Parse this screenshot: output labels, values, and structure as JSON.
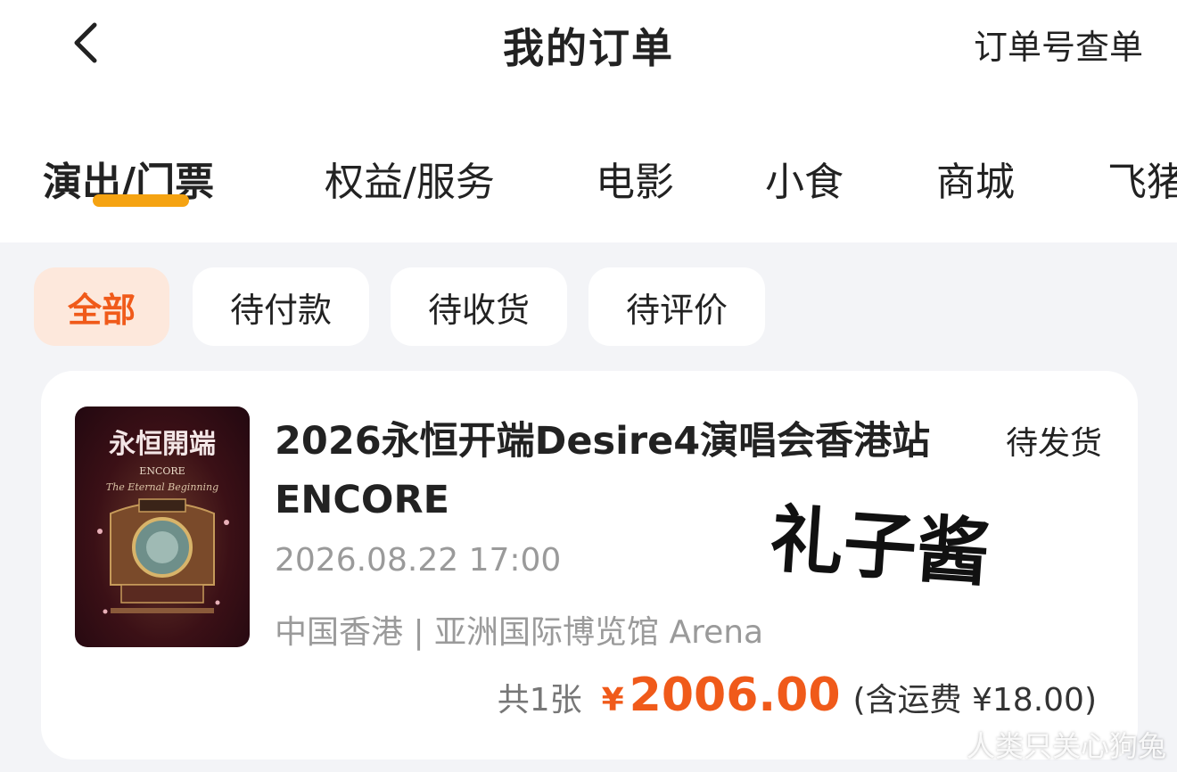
{
  "header": {
    "back_icon": "chevron-left-icon",
    "title": "我的订单",
    "lookup": "订单号查单"
  },
  "tabs": [
    {
      "label": "演出/门票",
      "active": true
    },
    {
      "label": "权益/服务",
      "active": false
    },
    {
      "label": "电影",
      "active": false
    },
    {
      "label": "小食",
      "active": false
    },
    {
      "label": "商城",
      "active": false
    },
    {
      "label": "飞猪",
      "active": false
    }
  ],
  "filters": [
    {
      "label": "全部",
      "active": true
    },
    {
      "label": "待付款",
      "active": false
    },
    {
      "label": "待收货",
      "active": false
    },
    {
      "label": "待评价",
      "active": false
    }
  ],
  "order": {
    "title": "2026永恒开端Desire4演唱会香港站ENCORE",
    "status": "待发货",
    "datetime": "2026.08.22 17:00",
    "venue": "中国香港 | 亚洲国际博览馆 Arena",
    "quantity": "共1张",
    "currency": "¥",
    "amount": "2006.00",
    "shipping": "(含运费 ¥18.00)",
    "poster": {
      "title_text": "永恒開端",
      "subtitle": "ENCORE",
      "script": "The Eternal Beginning"
    }
  },
  "overlay": {
    "handwritten": "礼子酱",
    "watermark": "人类只关心狗兔"
  },
  "colors": {
    "accent": "#f05a1a",
    "tab_underline": "#f5a312",
    "background": "#f3f4f7"
  }
}
